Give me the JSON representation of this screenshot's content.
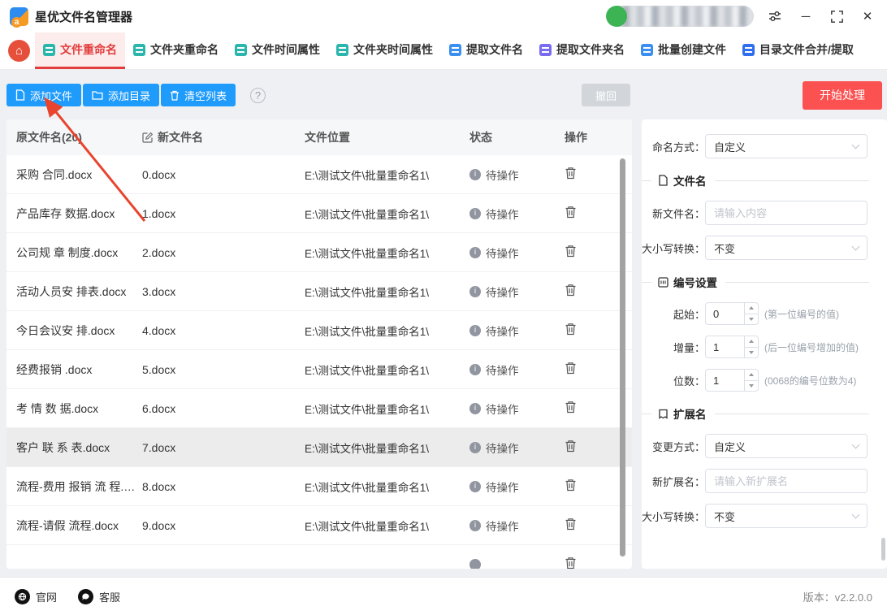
{
  "titlebar": {
    "app_title": "星优文件名管理器"
  },
  "icons": {
    "home": "⌂",
    "help": "?",
    "info": "i",
    "minimize": "─",
    "close": "✕"
  },
  "colors": {
    "accent_blue": "#1f9bfb",
    "accent_red": "#fb5151",
    "tab_active_red": "#e23c3c",
    "teal_icon": "#2ab5ad",
    "blue_icon": "#3a8ff0",
    "purple_icon": "#7a6bf0",
    "avatar_green": "#3cb454"
  },
  "tabs": [
    {
      "id": "file-rename",
      "label": "文件重命名",
      "icon": "file-rename-icon",
      "icon_color": "#2ab5ad",
      "active": true
    },
    {
      "id": "folder-rename",
      "label": "文件夹重命名",
      "icon": "folder-rename-icon",
      "icon_color": "#2ab5ad",
      "active": false
    },
    {
      "id": "file-time",
      "label": "文件时间属性",
      "icon": "file-time-icon",
      "icon_color": "#2ab5ad",
      "active": false
    },
    {
      "id": "folder-time",
      "label": "文件夹时间属性",
      "icon": "folder-time-icon",
      "icon_color": "#2ab5ad",
      "active": false
    },
    {
      "id": "extract-filename",
      "label": "提取文件名",
      "icon": "extract-filename-icon",
      "icon_color": "#3a8ff0",
      "active": false
    },
    {
      "id": "extract-foldername",
      "label": "提取文件夹名",
      "icon": "extract-foldername-icon",
      "icon_color": "#7a6bf0",
      "active": false
    },
    {
      "id": "batch-create",
      "label": "批量创建文件",
      "icon": "batch-create-icon",
      "icon_color": "#3a8ff0",
      "active": false
    },
    {
      "id": "merge-extract",
      "label": "目录文件合并/提取",
      "icon": "merge-extract-icon",
      "icon_color": "#2f6fed",
      "active": false
    }
  ],
  "toolbar": {
    "add_file_label": "添加文件",
    "add_dir_label": "添加目录",
    "clear_label": "清空列表",
    "undo_label": "撤回",
    "start_label": "开始处理"
  },
  "table": {
    "headers": [
      "原文件名(20)",
      "新文件名",
      "文件位置",
      "状态",
      "操作"
    ],
    "selected_row_index": 7,
    "partial_row_visible": true,
    "rows": [
      {
        "original": "采购 合同.docx",
        "new_name": "0.docx",
        "path": "E:\\测试文件\\批量重命名1\\",
        "status": "待操作"
      },
      {
        "original": "产品库存 数据.docx",
        "new_name": "1.docx",
        "path": "E:\\测试文件\\批量重命名1\\",
        "status": "待操作"
      },
      {
        "original": "公司规 章 制度.docx",
        "new_name": "2.docx",
        "path": "E:\\测试文件\\批量重命名1\\",
        "status": "待操作"
      },
      {
        "original": "活动人员安 排表.docx",
        "new_name": "3.docx",
        "path": "E:\\测试文件\\批量重命名1\\",
        "status": "待操作"
      },
      {
        "original": "今日会议安 排.docx",
        "new_name": "4.docx",
        "path": "E:\\测试文件\\批量重命名1\\",
        "status": "待操作"
      },
      {
        "original": "经费报销 .docx",
        "new_name": "5.docx",
        "path": "E:\\测试文件\\批量重命名1\\",
        "status": "待操作"
      },
      {
        "original": "考 情 数 据.docx",
        "new_name": "6.docx",
        "path": "E:\\测试文件\\批量重命名1\\",
        "status": "待操作"
      },
      {
        "original": "客户 联 系 表.docx",
        "new_name": "7.docx",
        "path": "E:\\测试文件\\批量重命名1\\",
        "status": "待操作"
      },
      {
        "original": "流程-费用 报销 流 程.d...",
        "new_name": "8.docx",
        "path": "E:\\测试文件\\批量重命名1\\",
        "status": "待操作"
      },
      {
        "original": "流程-请假 流程.docx",
        "new_name": "9.docx",
        "path": "E:\\测试文件\\批量重命名1\\",
        "status": "待操作"
      }
    ]
  },
  "panel": {
    "naming_label": "命名方式：",
    "naming_value": "自定义",
    "filename_section": "文件名",
    "new_name_label": "新文件名：",
    "new_name_placeholder": "请输入内容",
    "case_label": "大小写转换：",
    "case_value": "不变",
    "number_section": "编号设置",
    "start_label": "起始：",
    "start_value": "0",
    "start_hint": "(第一位编号的值)",
    "increment_label": "增量：",
    "increment_value": "1",
    "increment_hint": "(后一位编号增加的值)",
    "digits_label": "位数：",
    "digits_value": "1",
    "digits_hint": "(0068的编号位数为4)",
    "ext_section": "扩展名",
    "change_label": "变更方式：",
    "change_value": "自定义",
    "new_ext_label": "新扩展名：",
    "new_ext_placeholder": "请输入新扩展名",
    "ext_case_label": "大小写转换：",
    "ext_case_value": "不变"
  },
  "footer": {
    "site_label": "官网",
    "support_label": "客服",
    "version": "版本：v2.2.0.0"
  }
}
